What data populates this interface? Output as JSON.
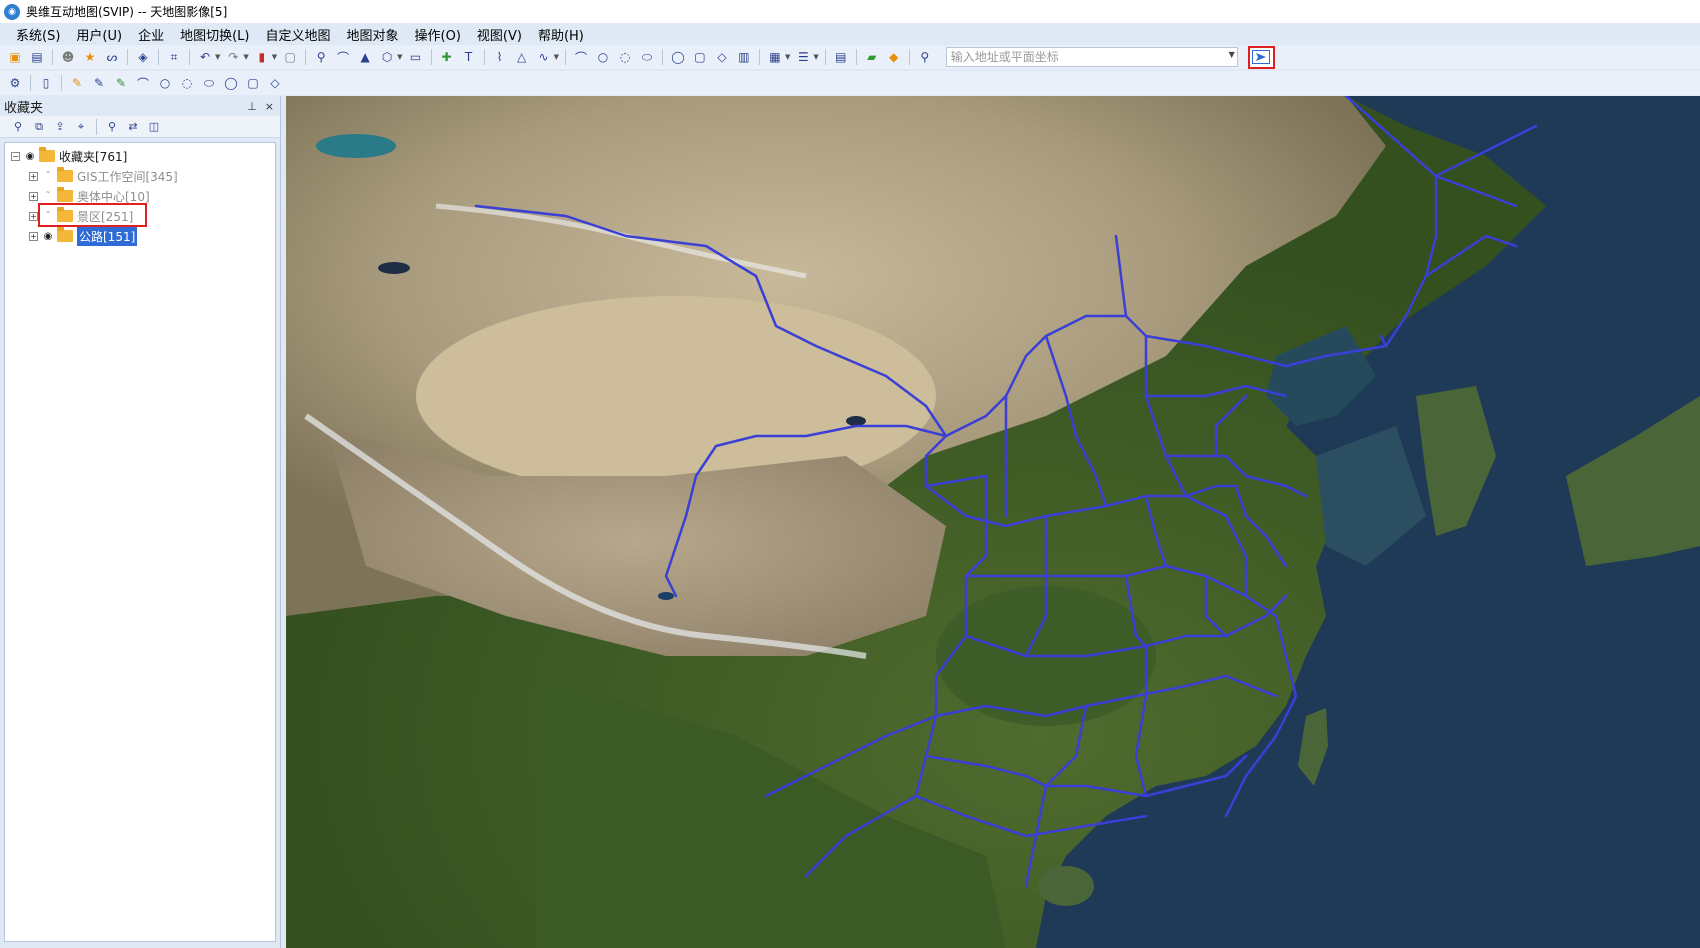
{
  "window": {
    "title": "奥维互动地图(SVIP) -- 天地图影像[5]"
  },
  "menubar": {
    "items": [
      "系统(S)",
      "用户(U)",
      "企业",
      "地图切换(L)",
      "自定义地图",
      "地图对象",
      "操作(O)",
      "视图(V)",
      "帮助(H)"
    ]
  },
  "toolbar": {
    "search_placeholder": "输入地址或平面坐标"
  },
  "panel": {
    "title": "收藏夹",
    "pin": "ᵖ",
    "close": "×"
  },
  "tree": {
    "root_label": "收藏夹[761]",
    "children": [
      {
        "label": "GIS工作空间[345]",
        "visible": false
      },
      {
        "label": "奥体中心[10]",
        "visible": false
      },
      {
        "label": "景区[251]",
        "visible": false
      },
      {
        "label": "公路[151]",
        "visible": true,
        "selected": true
      }
    ]
  },
  "map": {
    "layer": "天地图影像",
    "road_color": "#3a3fd6"
  }
}
